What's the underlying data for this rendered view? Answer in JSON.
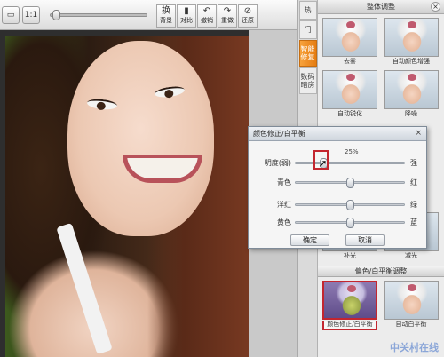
{
  "toolbar": {
    "zoom_percent": 2,
    "tools_a": [
      {
        "icon": "background-icon",
        "glyph": "换",
        "label": "背景"
      },
      {
        "icon": "compare-icon",
        "glyph": "▮",
        "label": "对比"
      }
    ],
    "tools_b": [
      {
        "icon": "undo-icon",
        "glyph": "↶",
        "label": "撤销"
      },
      {
        "icon": "redo-icon",
        "glyph": "↷",
        "label": "重做"
      },
      {
        "icon": "restore-icon",
        "glyph": "⊘",
        "label": "还原"
      }
    ]
  },
  "side_tabs": [
    {
      "label": "热",
      "active": false
    },
    {
      "label": "门",
      "active": false
    },
    {
      "label": "智能修复",
      "active": true
    },
    {
      "label": "数码暗房",
      "active": false
    }
  ],
  "panel": {
    "header": "整体调整",
    "thumbs_top": [
      "去雾",
      "自动颜色增强",
      "自动锐化",
      "降噪"
    ],
    "thumbs_mid": [
      "补光",
      "减光"
    ],
    "section2": "偏色/白平衡调整",
    "thumbs_bottom": [
      "颜色修正/白平衡",
      "自动白平衡"
    ]
  },
  "dialog": {
    "title": "颜色修正/白平衡",
    "close": "×",
    "percent": "25%",
    "sliders": [
      {
        "left": "明度(弱)",
        "right": "强",
        "value": 0.25
      },
      {
        "left": "青色",
        "right": "红",
        "value": 0.5
      },
      {
        "left": "洋红",
        "right": "绿",
        "value": 0.5
      },
      {
        "left": "黄色",
        "right": "蓝",
        "value": 0.5
      }
    ],
    "ok": "确定",
    "cancel": "取消"
  },
  "watermark": "中关村在线"
}
